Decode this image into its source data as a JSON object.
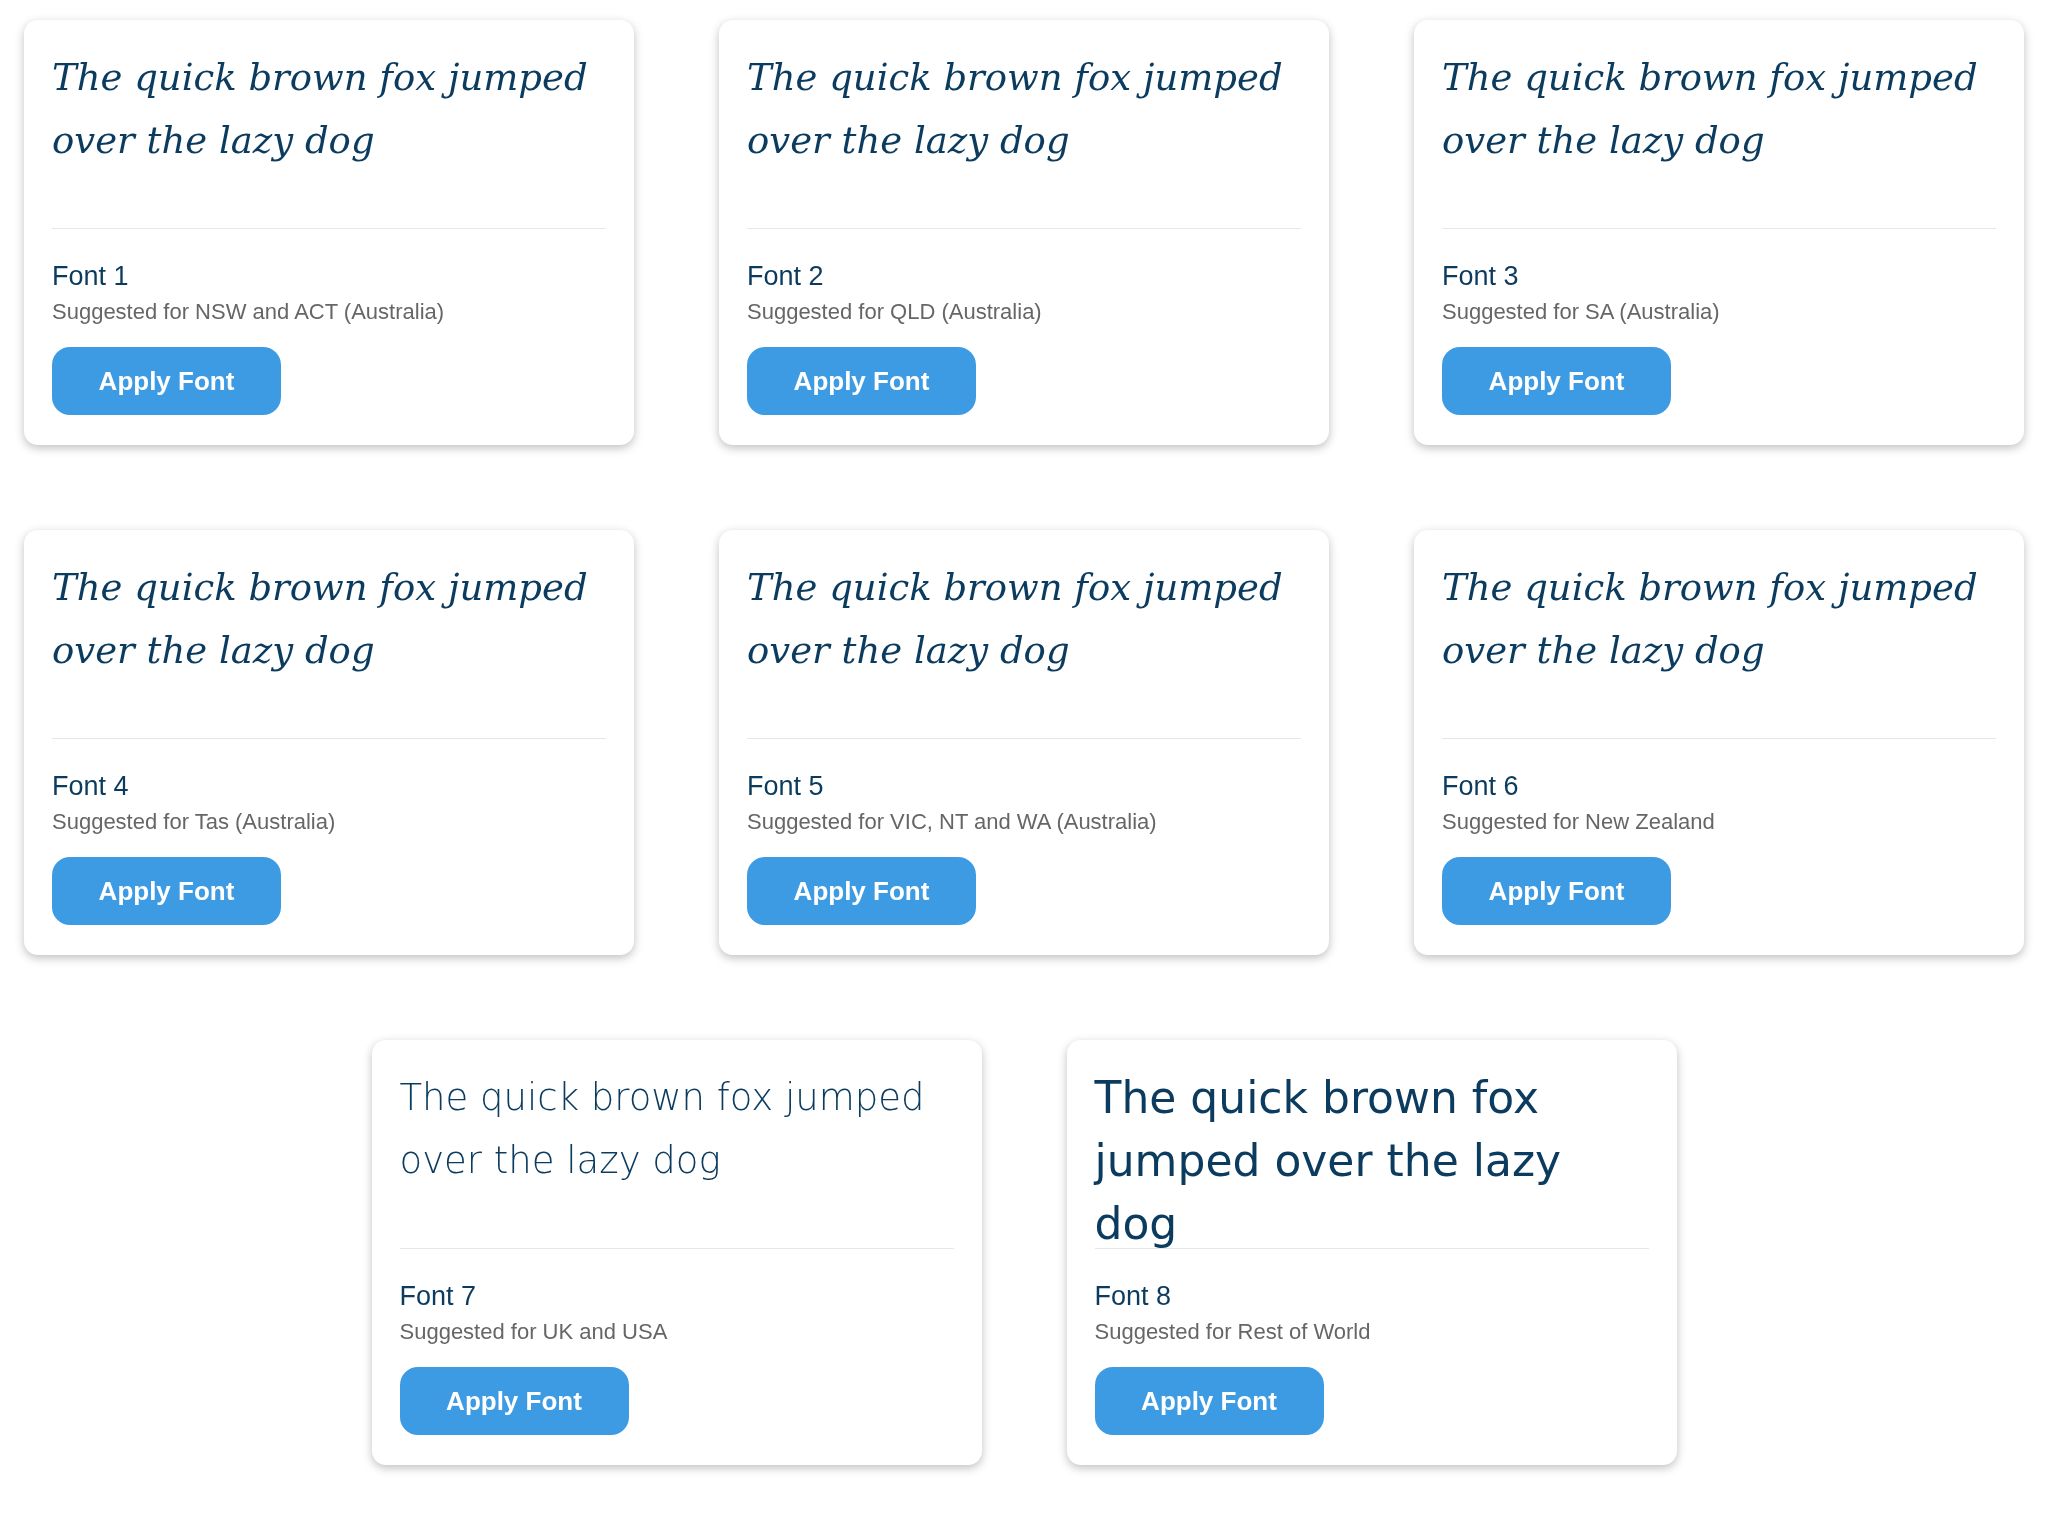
{
  "cards": [
    {
      "sample": "The quick brown fox jumped over the lazy dog",
      "kind": "cursive",
      "name": "Font 1",
      "note": "Suggested for NSW and ACT (Australia)",
      "button": "Apply Font"
    },
    {
      "sample": "The quick brown fox jumped over the lazy dog",
      "kind": "cursive",
      "name": "Font 2",
      "note": "Suggested for QLD (Australia)",
      "button": "Apply Font"
    },
    {
      "sample": "The quick brown fox jumped over the lazy dog",
      "kind": "cursive",
      "name": "Font 3",
      "note": "Suggested for SA (Australia)",
      "button": "Apply Font"
    },
    {
      "sample": "The quick brown fox jumped over the lazy dog",
      "kind": "cursive",
      "name": "Font 4",
      "note": "Suggested for Tas (Australia)",
      "button": "Apply Font"
    },
    {
      "sample": "The quick brown fox jumped over the lazy dog",
      "kind": "cursive",
      "name": "Font 5",
      "note": "Suggested for VIC, NT and WA (Australia)",
      "button": "Apply Font"
    },
    {
      "sample": "The quick brown fox jumped over the lazy dog",
      "kind": "cursive",
      "name": "Font 6",
      "note": "Suggested for New Zealand",
      "button": "Apply Font"
    },
    {
      "sample": "The quick brown fox jumped over the lazy dog",
      "kind": "print",
      "name": "Font 7",
      "note": "Suggested for UK and USA",
      "button": "Apply Font"
    },
    {
      "sample": "The quick brown fox jumped over the lazy dog",
      "kind": "bold",
      "name": "Font 8",
      "note": "Suggested for Rest of World",
      "button": "Apply Font"
    }
  ]
}
